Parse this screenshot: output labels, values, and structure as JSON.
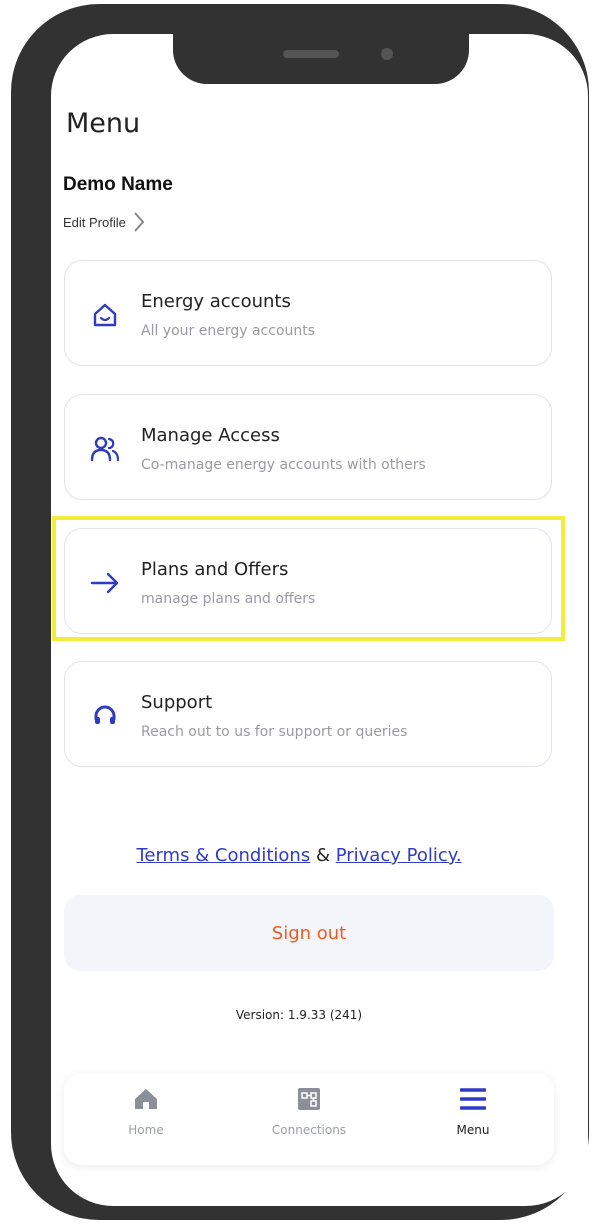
{
  "page": {
    "title": "Menu"
  },
  "profile": {
    "name": "Demo Name",
    "edit_label": "Edit Profile"
  },
  "menu_items": [
    {
      "title": "Energy accounts",
      "subtitle": "All your energy accounts",
      "icon": "home-icon"
    },
    {
      "title": "Manage Access",
      "subtitle": "Co-manage energy accounts with others",
      "icon": "users-icon"
    },
    {
      "title": "Plans and Offers",
      "subtitle": "manage plans and offers",
      "icon": "arrow-right-icon"
    },
    {
      "title": "Support",
      "subtitle": "Reach out to us for support or queries",
      "icon": "headset-icon"
    }
  ],
  "legal": {
    "terms": "Terms & Conditions",
    "separator": "&",
    "privacy": "Privacy Policy."
  },
  "signout_label": "Sign out",
  "version_text": "Version: 1.9.33 (241)",
  "tabbar": {
    "items": [
      {
        "label": "Home",
        "icon": "home-filled-icon",
        "active": false
      },
      {
        "label": "Connections",
        "icon": "connections-icon",
        "active": false
      },
      {
        "label": "Menu",
        "icon": "menu-icon",
        "active": true
      }
    ]
  },
  "colors": {
    "accent": "#2f3bc3",
    "signout": "#f25a1e",
    "highlight": "#f4ec3c",
    "frame": "#323232"
  }
}
